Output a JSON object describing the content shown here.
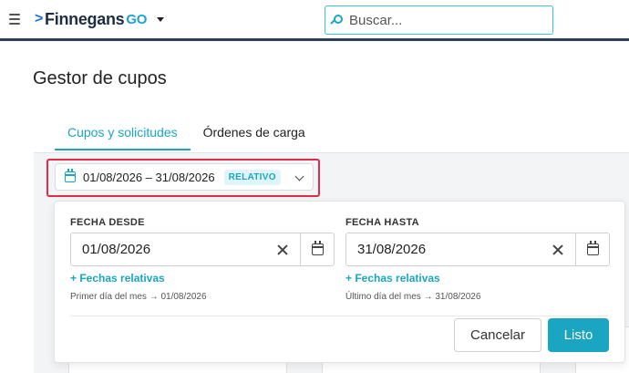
{
  "header": {
    "logo_text": "Finnegans",
    "logo_suffix": "GO",
    "search_placeholder": "Buscar..."
  },
  "page": {
    "title": "Gestor de cupos"
  },
  "tabs": [
    {
      "label": "Cupos y solicitudes",
      "active": true
    },
    {
      "label": "Órdenes de carga",
      "active": false
    }
  ],
  "range_selector": {
    "value": "01/08/2026 – 31/08/2026",
    "badge": "RELATIVO"
  },
  "popover": {
    "from": {
      "label": "FECHA DESDE",
      "value": "01/08/2026",
      "relative_link": "+ Fechas relativas",
      "hint": "Primer día del mes → 01/08/2026"
    },
    "to": {
      "label": "FECHA HASTA",
      "value": "31/08/2026",
      "relative_link": "+ Fechas relativas",
      "hint": "Último día del mes → 31/08/2026"
    },
    "cancel_label": "Cancelar",
    "ok_label": "Listo"
  },
  "colors": {
    "accent": "#1aa6c2",
    "highlight": "#e02d4a",
    "header_border": "#2c3e5a"
  }
}
